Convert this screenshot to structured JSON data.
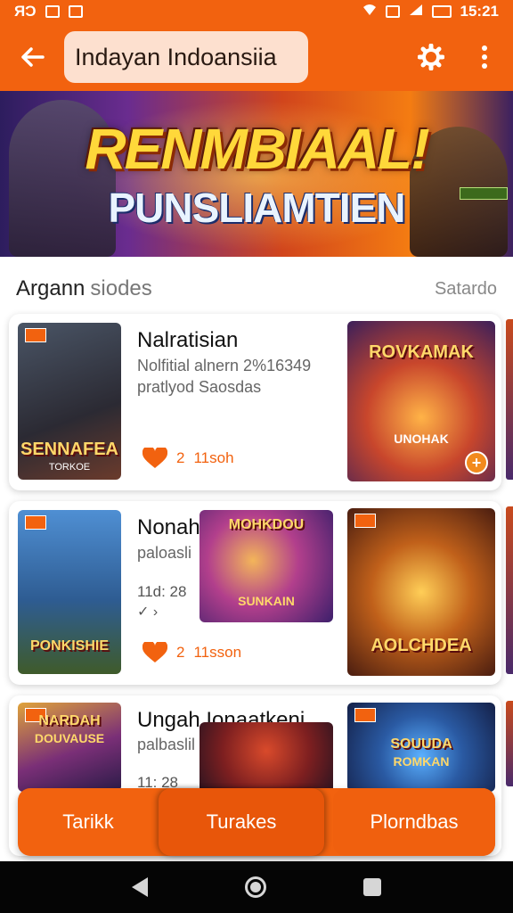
{
  "status_bar": {
    "left_text": "ЯƆ",
    "time": "15:21"
  },
  "app_bar": {
    "title": "Indayan Indoansiia"
  },
  "banner": {
    "title": "RENMBIAAL!",
    "subtitle": "PUNSLIAMTIEN"
  },
  "section": {
    "title": "Argann",
    "subtitle": "siodes",
    "link": "Satardo"
  },
  "cards": [
    {
      "title": "Nalratisian",
      "desc_line1": "Nolfitial alnern 2%16349",
      "desc_line2": "pratlyod Saosdas",
      "likes": "2",
      "meta": "11soh",
      "thumb_left": {
        "caption": "SENNAFEA",
        "sub": "TORKOE"
      },
      "thumb_right": {
        "caption": "ROVKAMAK",
        "sub": "UNOHAK"
      }
    },
    {
      "title": "Nonah",
      "desc_line1": "paloasli",
      "time": "11d: 28",
      "likes": "2",
      "meta": "11sson",
      "thumb_left": {
        "caption": "PONKISHIE",
        "sub": ""
      },
      "thumb_mid": {
        "caption": "MOHKDOU",
        "sub": "SUNKAIN"
      },
      "thumb_right": {
        "caption": "AOLCHDEA",
        "sub": ""
      }
    },
    {
      "title": "Ungah Ionaatkeni",
      "desc_line1": "palbaslil",
      "time": "11: 28",
      "thumb_left": {
        "caption": "NARDAH",
        "sub": "DOUVAUSE"
      },
      "thumb_right": {
        "caption": "SOUUDA",
        "sub": "ROMKAN"
      }
    }
  ],
  "bottom_tabs": [
    "Tarikk",
    "Turakes",
    "Plorndbas"
  ]
}
